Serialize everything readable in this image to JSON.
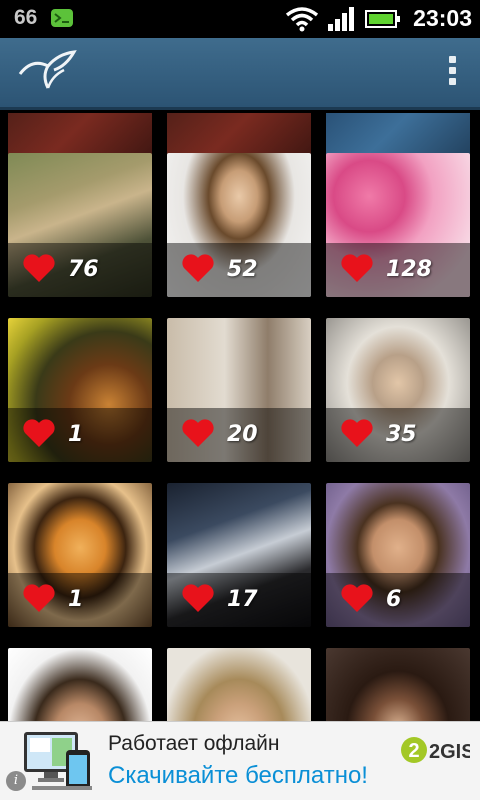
{
  "status_bar": {
    "left_number": "66",
    "time": "23:03",
    "icons": [
      "android-app-icon",
      "wifi-icon",
      "signal-icon",
      "battery-icon"
    ]
  },
  "action_bar": {
    "logo_icon": "bird-logo-icon",
    "menu_icon": "overflow-menu-icon"
  },
  "grid": {
    "like_icon": "heart-icon",
    "tiles": [
      {
        "likes": "",
        "kind": "partial-dark-red"
      },
      {
        "likes": "",
        "kind": "partial-dark-red"
      },
      {
        "likes": "",
        "kind": "partial-blue"
      },
      {
        "likes": "76",
        "kind": "woman-on-bench"
      },
      {
        "likes": "52",
        "kind": "bride-portrait"
      },
      {
        "likes": "128",
        "kind": "pink-roses"
      },
      {
        "likes": "1",
        "kind": "tiger-yellow-flowers"
      },
      {
        "likes": "20",
        "kind": "woman-grey-dress"
      },
      {
        "likes": "35",
        "kind": "blonde-portrait"
      },
      {
        "likes": "1",
        "kind": "tiger-close"
      },
      {
        "likes": "17",
        "kind": "woman-in-car"
      },
      {
        "likes": "6",
        "kind": "man-smiling"
      },
      {
        "likes": "",
        "kind": "man-portrait"
      },
      {
        "likes": "",
        "kind": "man-blond"
      },
      {
        "likes": "",
        "kind": "woman-dark-hair"
      }
    ]
  },
  "ad": {
    "line1": "Работает офлайн",
    "line2": "Скачивайте бесплатно!",
    "brand": "2GIS",
    "info": "i"
  },
  "colors": {
    "action_bar": "#3a6586",
    "heart": "#e8121b",
    "ad_link": "#0a8fd6"
  }
}
